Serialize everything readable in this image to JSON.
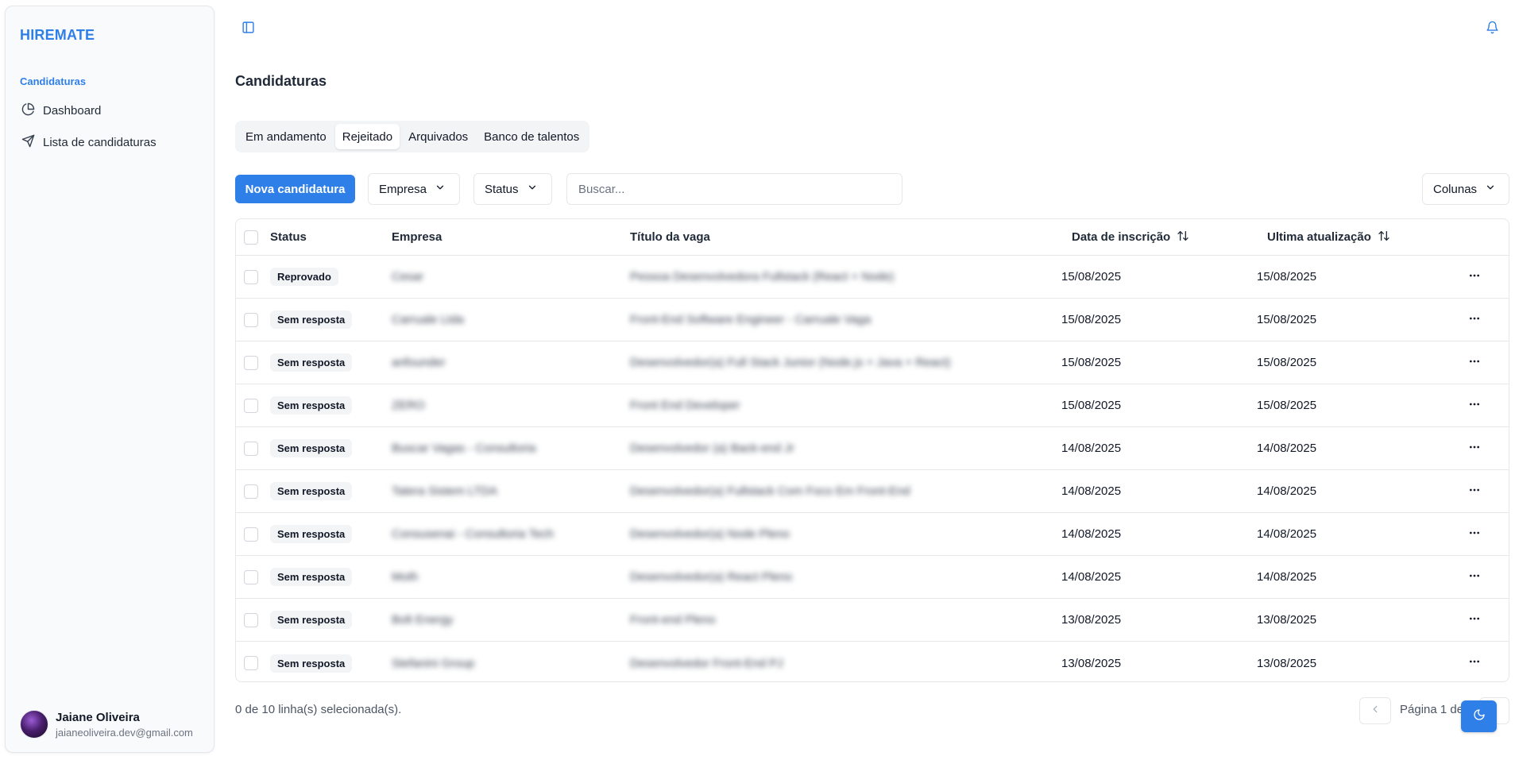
{
  "sidebar": {
    "brand": "HIREMATE",
    "section_label": "Candidaturas",
    "items": [
      {
        "label": "Dashboard",
        "icon": "pie-chart-icon"
      },
      {
        "label": "Lista de candidaturas",
        "icon": "send-icon"
      }
    ],
    "user": {
      "name": "Jaiane Oliveira",
      "email": "jaianeoliveira.dev@gmail.com"
    }
  },
  "header": {
    "toggle_icon": "sidebar-toggle-icon",
    "bell_icon": "bell-icon"
  },
  "page": {
    "title": "Candidaturas"
  },
  "tabs": [
    {
      "label": "Em andamento",
      "active": false
    },
    {
      "label": "Rejeitado",
      "active": true
    },
    {
      "label": "Arquivados",
      "active": false
    },
    {
      "label": "Banco de talentos",
      "active": false
    }
  ],
  "toolbar": {
    "new_label": "Nova candidatura",
    "company_filter": "Empresa",
    "status_filter": "Status",
    "search_placeholder": "Buscar...",
    "columns_label": "Colunas"
  },
  "table": {
    "headers": {
      "status": "Status",
      "company": "Empresa",
      "job_title": "Título da vaga",
      "applied": "Data de inscrição",
      "updated": "Ultima atualização"
    },
    "rows": [
      {
        "status": "Reprovado",
        "company": "Cesar",
        "job": "Pessoa Desenvolvedora Fullstack (React + Node)",
        "applied": "15/08/2025",
        "updated": "15/08/2025"
      },
      {
        "status": "Sem resposta",
        "company": "Carruale Ltda",
        "job": "Front-End Software Engineer - Carruale Vaga",
        "applied": "15/08/2025",
        "updated": "15/08/2025"
      },
      {
        "status": "Sem resposta",
        "company": "anfounder",
        "job": "Desenvolvedor(a) Full Stack Junior (Node.js + Java + React)",
        "applied": "15/08/2025",
        "updated": "15/08/2025"
      },
      {
        "status": "Sem resposta",
        "company": "ZERO",
        "job": "Front End Developer",
        "applied": "15/08/2025",
        "updated": "15/08/2025"
      },
      {
        "status": "Sem resposta",
        "company": "Buscar Vagas - Consultoria",
        "job": "Desenvolvedor (a) Back-end Jr",
        "applied": "14/08/2025",
        "updated": "14/08/2025"
      },
      {
        "status": "Sem resposta",
        "company": "Tatera Sistem LTDA",
        "job": "Desenvolvedor(a) Fullstack Com Foco Em Front-End",
        "applied": "14/08/2025",
        "updated": "14/08/2025"
      },
      {
        "status": "Sem resposta",
        "company": "Consusenai - Consultoria Tech",
        "job": "Desenvolvedor(a) Node Pleno",
        "applied": "14/08/2025",
        "updated": "14/08/2025"
      },
      {
        "status": "Sem resposta",
        "company": "Moth",
        "job": "Desenvolvedor(a) React Pleno",
        "applied": "14/08/2025",
        "updated": "14/08/2025"
      },
      {
        "status": "Sem resposta",
        "company": "Bolt Energy",
        "job": "Front-end Pleno",
        "applied": "13/08/2025",
        "updated": "13/08/2025"
      },
      {
        "status": "Sem resposta",
        "company": "Stefanini Group",
        "job": "Desenvolvedor Front-End PJ",
        "applied": "13/08/2025",
        "updated": "13/08/2025"
      }
    ]
  },
  "footer": {
    "selection_text": "0 de 10 linha(s) selecionada(s).",
    "page_text": "Página 1 de"
  }
}
